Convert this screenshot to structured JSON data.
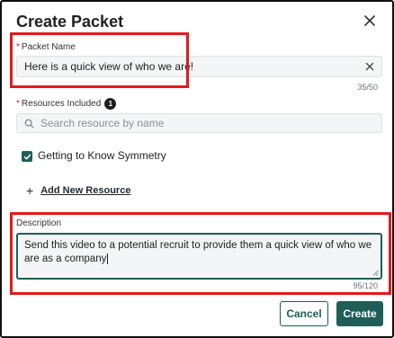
{
  "dialog": {
    "title": "Create Packet"
  },
  "packet_name": {
    "required_marker": "*",
    "label": "Packet Name",
    "value": "Here is a quick view of who we are!",
    "char_count": "35/50"
  },
  "resources": {
    "required_marker": "*",
    "label": "Resources Included",
    "count_badge": "1",
    "search_placeholder": "Search resource by name",
    "items": [
      {
        "label": "Getting to Know Symmetry",
        "checked": true
      }
    ],
    "add_label": "Add New Resource"
  },
  "description": {
    "label": "Description",
    "value": "Send this video to a potential recruit to provide them a quick view of who we are as a company",
    "char_count": "95/120"
  },
  "footer": {
    "cancel_label": "Cancel",
    "create_label": "Create"
  },
  "colors": {
    "accent": "#1e5e56",
    "highlight_red": "#e21b1b"
  }
}
